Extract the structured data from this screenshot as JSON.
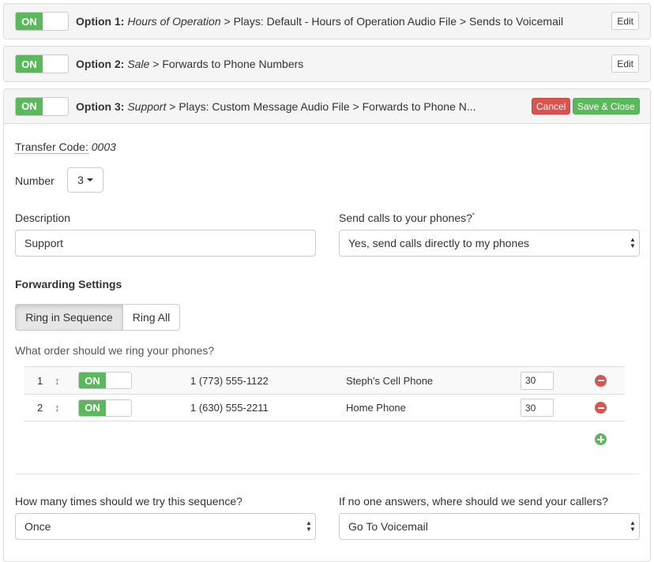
{
  "options": [
    {
      "toggle": "ON",
      "number_label": "Option 1:",
      "name": "Hours of Operation",
      "rest": " > Plays: Default - Hours of Operation Audio File > Sends to Voicemail",
      "edit_label": "Edit"
    },
    {
      "toggle": "ON",
      "number_label": "Option 2:",
      "name": "Sale",
      "rest": " > Forwards to Phone Numbers",
      "edit_label": "Edit"
    },
    {
      "toggle": "ON",
      "number_label": "Option 3:",
      "name": "Support",
      "rest": " > Plays: Custom Message Audio File > Forwards to Phone N...",
      "cancel_label": "Cancel",
      "save_label": "Save & Close"
    }
  ],
  "editor": {
    "transfer_code_label": "Transfer Code:",
    "transfer_code_value": "0003",
    "number_label": "Number",
    "number_value": "3",
    "description_label": "Description",
    "description_value": "Support",
    "send_calls_label": "Send calls to your phones?",
    "send_calls_required_mark": "*",
    "send_calls_value": "Yes, send calls directly to my phones",
    "forwarding_heading": "Forwarding Settings",
    "mode_sequence_label": "Ring in Sequence",
    "mode_all_label": "Ring All",
    "order_question": "What order should we ring your phones?",
    "phones": [
      {
        "order": "1",
        "toggle": "ON",
        "number": "1 (773) 555-1122",
        "name": "Steph's Cell Phone",
        "ring_seconds": "30"
      },
      {
        "order": "2",
        "toggle": "ON",
        "number": "1 (630) 555-2211",
        "name": "Home Phone",
        "ring_seconds": "30"
      }
    ],
    "tries_label": "How many times should we try this sequence?",
    "tries_value": "Once",
    "no_answer_label": "If no one answers, where should we send your callers?",
    "no_answer_value": "Go To Voicemail"
  },
  "colors": {
    "toggle_on": "#5cb85c",
    "cancel": "#d9534f",
    "save": "#5cb85c"
  }
}
